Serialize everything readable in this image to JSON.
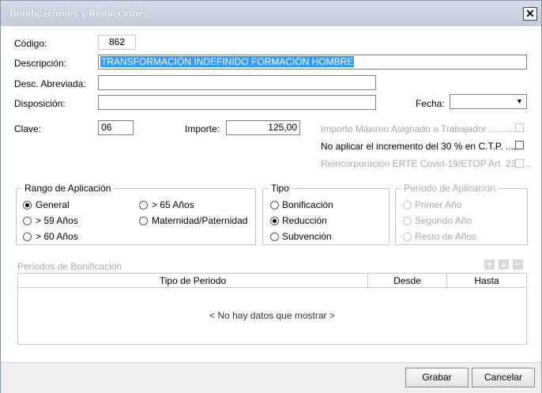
{
  "window": {
    "title": "Bonificaciones y Reducciones",
    "close_glyph": "✕"
  },
  "form": {
    "codigo_label": "Código:",
    "codigo_value": "862",
    "descripcion_label": "Descripción:",
    "descripcion_value": "TRANSFORMACIÓN INDEFINIDO FORMACIÓN HOMBRE",
    "desc_abreviada_label": "Desc. Abreviada:",
    "desc_abreviada_value": "",
    "disposicion_label": "Disposición:",
    "disposicion_value": "",
    "fecha_label": "Fecha:",
    "fecha_value": "",
    "clave_label": "Clave:",
    "clave_value": "06",
    "importe_label": "Importe:",
    "importe_value": "125,00",
    "checks": [
      {
        "label": "Importe Máximo Asignado a Trabajador ............",
        "checked": false,
        "enabled": false
      },
      {
        "label": "No aplicar el incremento del 30 % en C.T.P. .......",
        "checked": false,
        "enabled": true
      },
      {
        "label": "Reincorporación ERTE Covid-19/ETOP Art. 23 .....",
        "checked": false,
        "enabled": false
      }
    ]
  },
  "rango": {
    "legend": "Rango de Aplicación",
    "options": [
      {
        "label": "General",
        "selected": true
      },
      {
        "label": "> 59 Años",
        "selected": false
      },
      {
        "label": "> 60 Años",
        "selected": false
      },
      {
        "label": "> 65 Años",
        "selected": false
      },
      {
        "label": "Maternidad/Paternidad",
        "selected": false
      }
    ]
  },
  "tipo": {
    "legend": "Tipo",
    "options": [
      {
        "label": "Bonificación",
        "selected": false
      },
      {
        "label": "Reducción",
        "selected": true
      },
      {
        "label": "Subvención",
        "selected": false
      }
    ]
  },
  "periodo": {
    "legend": "Período de Aplicación",
    "options": [
      {
        "label": "Primer Año",
        "selected": false
      },
      {
        "label": "Segundo Año",
        "selected": false
      },
      {
        "label": "Resto de Años",
        "selected": false
      }
    ]
  },
  "periodos_bonificacion": {
    "title": "Periodos de Bonificación",
    "toolbar": {
      "add": "+",
      "up": "▲",
      "remove": "−"
    },
    "columns": [
      "Tipo de Periodo",
      "Desde",
      "Hasta"
    ],
    "rows": [],
    "empty_text": "< No hay datos que mostrar >"
  },
  "footer": {
    "grabar_label": "Grabar",
    "cancelar_label": "Cancelar"
  }
}
